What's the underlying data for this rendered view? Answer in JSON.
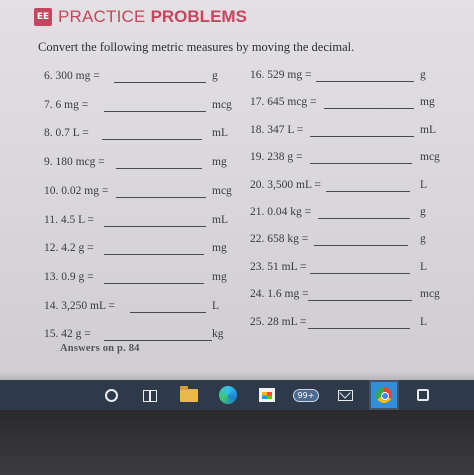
{
  "header": {
    "badge": "EE",
    "title_light": "PRACTICE",
    "title_bold": "PROBLEMS"
  },
  "instructions": "Convert the following metric measures by moving the decimal.",
  "problems_left": [
    {
      "q": "6.  300 mg =",
      "unit": "g"
    },
    {
      "q": "7.  6 mg =",
      "unit": "mcg"
    },
    {
      "q": "8.  0.7 L =",
      "unit": "mL"
    },
    {
      "q": "9.  180 mcg =",
      "unit": "mg"
    },
    {
      "q": "10.  0.02 mg =",
      "unit": "mcg"
    },
    {
      "q": "11.  4.5 L =",
      "unit": "mL"
    },
    {
      "q": "12.  4.2 g =",
      "unit": "mg"
    },
    {
      "q": "13.  0.9 g =",
      "unit": "mg"
    },
    {
      "q": "14.  3,250 mL =",
      "unit": "L"
    },
    {
      "q": "15.  42 g =",
      "unit": "kg"
    }
  ],
  "problems_right": [
    {
      "q": "16.  529 mg =",
      "unit": "g"
    },
    {
      "q": "17.  645 mcg =",
      "unit": "mg"
    },
    {
      "q": "18.  347 L =",
      "unit": "mL"
    },
    {
      "q": "19.  238 g =",
      "unit": "mcg"
    },
    {
      "q": "20.  3,500 mL =",
      "unit": "L"
    },
    {
      "q": "21.  0.04 kg =",
      "unit": "g"
    },
    {
      "q": "22.  658 kg =",
      "unit": "g"
    },
    {
      "q": "23.  51 mL =",
      "unit": "L"
    },
    {
      "q": "24.  1.6 mg =",
      "unit": "mcg"
    },
    {
      "q": "25.  28 mL =",
      "unit": "L"
    }
  ],
  "answers_note": "Answers on p. 84",
  "taskbar": {
    "mail_badge": "99+"
  }
}
